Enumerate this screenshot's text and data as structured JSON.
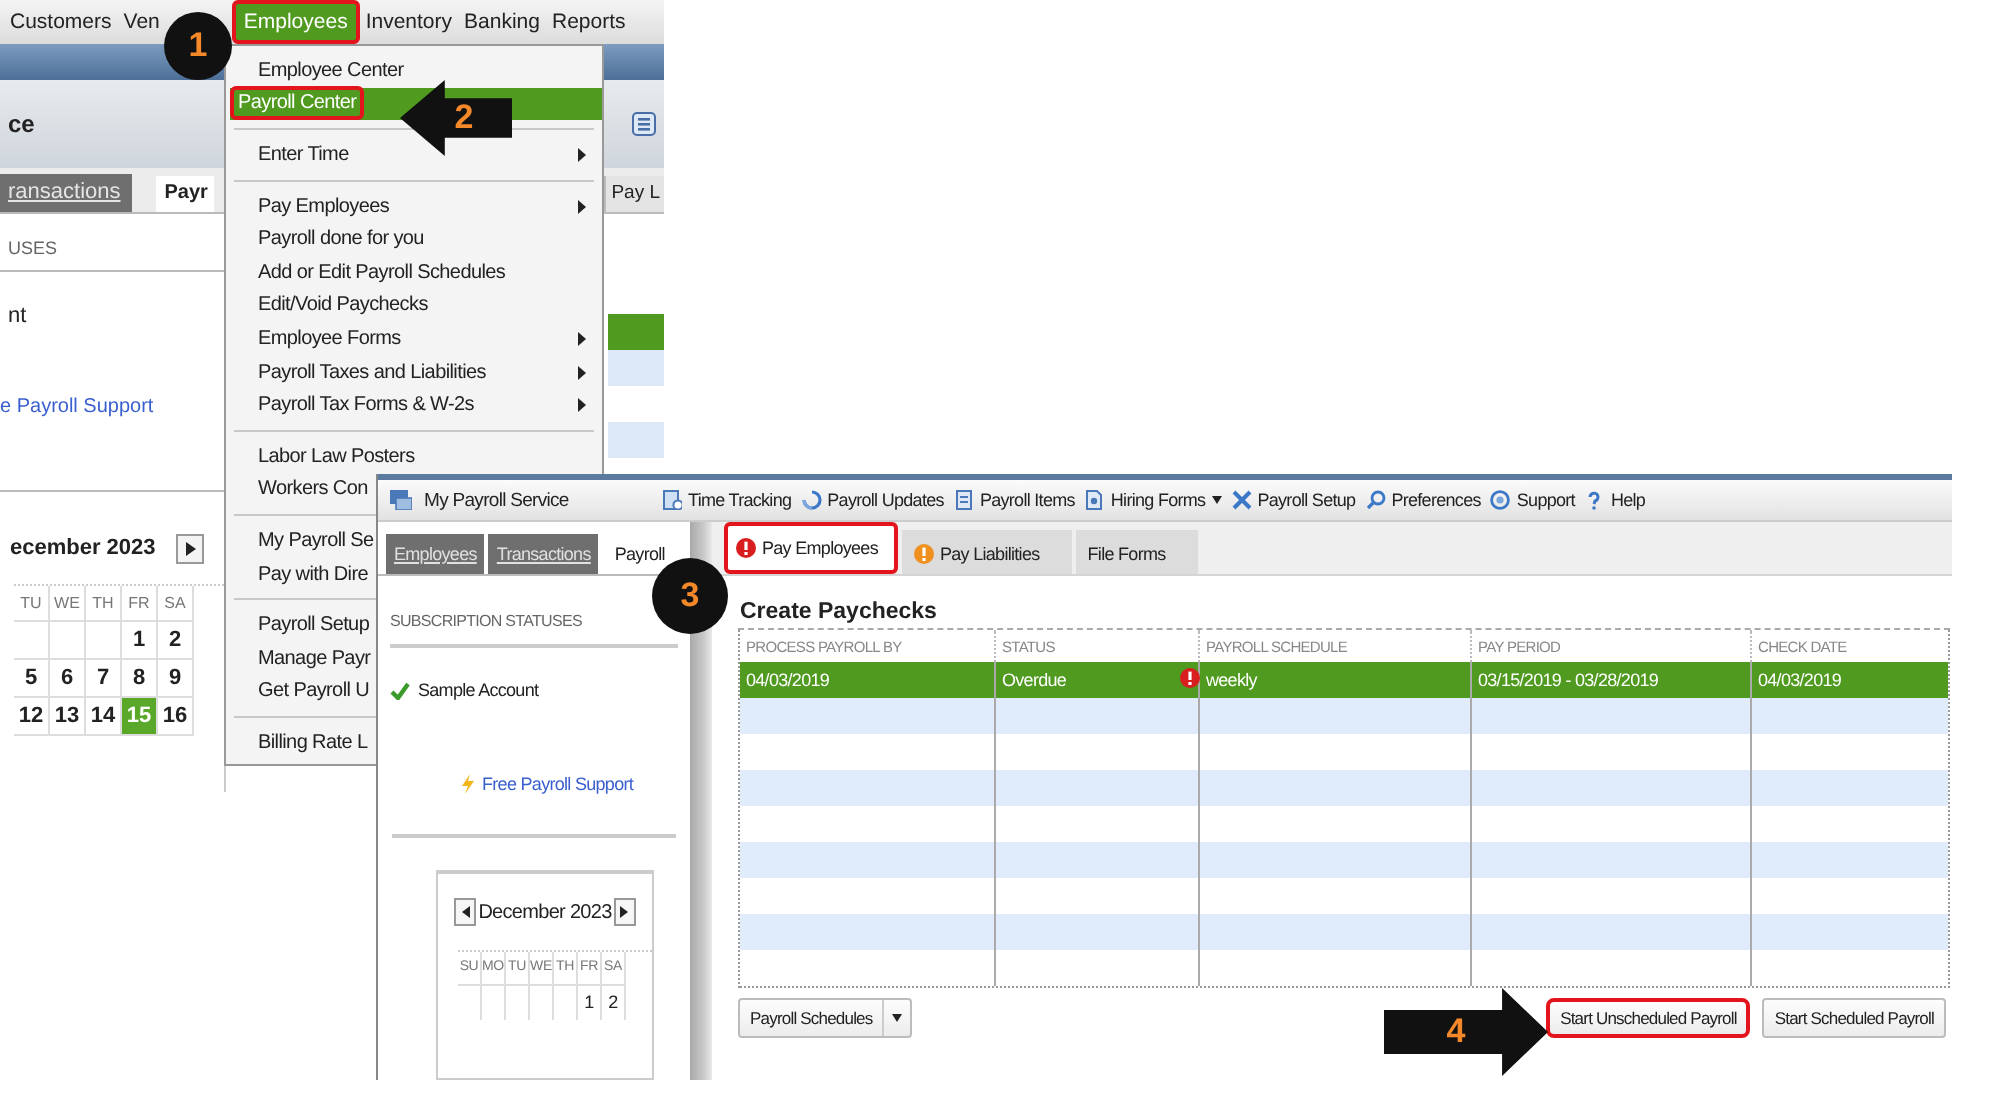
{
  "back_screenshot": {
    "menu_bar": [
      {
        "label": "Customers",
        "selected": false,
        "highlighted": false
      },
      {
        "label": "Ven",
        "selected": false,
        "highlighted": false
      },
      {
        "label": "Employees",
        "selected": true,
        "highlighted": true
      },
      {
        "label": "Inventory",
        "selected": false,
        "highlighted": false
      },
      {
        "label": "Banking",
        "selected": false,
        "highlighted": false
      },
      {
        "label": "Reports",
        "selected": false,
        "highlighted": false
      }
    ],
    "title": "ce",
    "tabs": [
      {
        "label": "ransactions",
        "selected": false
      },
      {
        "label": "Payr",
        "selected": true
      }
    ],
    "right_tab": "Pay L",
    "section_heading": "USES",
    "account": "nt",
    "support_link": "e Payroll Support",
    "calendar": {
      "month": "ecember 2023",
      "day_headers": [
        "TU",
        "WE",
        "TH",
        "FR",
        "SA"
      ],
      "weeks": [
        [
          {
            "day": "1",
            "selected": false
          },
          {
            "day": "2",
            "selected": false
          }
        ],
        [
          {
            "day": "5",
            "selected": false
          },
          {
            "day": "6",
            "selected": false
          },
          {
            "day": "7",
            "selected": false
          },
          {
            "day": "8",
            "selected": false
          },
          {
            "day": "9",
            "selected": false
          }
        ],
        [
          {
            "day": "12",
            "selected": false
          },
          {
            "day": "13",
            "selected": false
          },
          {
            "day": "14",
            "selected": false
          },
          {
            "day": "15",
            "selected": true
          },
          {
            "day": "16",
            "selected": false
          }
        ]
      ]
    },
    "menu": [
      {
        "kind": "item",
        "label": "Employee Center",
        "submenu": false,
        "selected": false,
        "highlighted": false
      },
      {
        "kind": "item",
        "label": "Payroll Center",
        "submenu": false,
        "selected": true,
        "highlighted": true
      },
      {
        "kind": "separator"
      },
      {
        "kind": "item",
        "label": "Enter Time",
        "submenu": true,
        "selected": false,
        "highlighted": false
      },
      {
        "kind": "separator"
      },
      {
        "kind": "item",
        "label": "Pay Employees",
        "submenu": true,
        "selected": false,
        "highlighted": false
      },
      {
        "kind": "item",
        "label": "Payroll done for you",
        "submenu": false,
        "selected": false,
        "highlighted": false
      },
      {
        "kind": "item",
        "label": "Add or Edit Payroll Schedules",
        "submenu": false,
        "selected": false,
        "highlighted": false
      },
      {
        "kind": "item",
        "label": "Edit/Void Paychecks",
        "submenu": false,
        "selected": false,
        "highlighted": false
      },
      {
        "kind": "item",
        "label": "Employee Forms",
        "submenu": true,
        "selected": false,
        "highlighted": false
      },
      {
        "kind": "item",
        "label": "Payroll Taxes and Liabilities",
        "submenu": true,
        "selected": false,
        "highlighted": false
      },
      {
        "kind": "item",
        "label": "Payroll Tax Forms & W-2s",
        "submenu": true,
        "selected": false,
        "highlighted": false
      },
      {
        "kind": "separator"
      },
      {
        "kind": "item",
        "label": "Labor Law Posters",
        "submenu": false,
        "selected": false,
        "highlighted": false
      },
      {
        "kind": "item",
        "label": "Workers Con",
        "submenu": false,
        "selected": false,
        "highlighted": false
      },
      {
        "kind": "separator"
      },
      {
        "kind": "item",
        "label": "My Payroll Se",
        "submenu": false,
        "selected": false,
        "highlighted": false
      },
      {
        "kind": "item",
        "label": "Pay with Dire",
        "submenu": false,
        "selected": false,
        "highlighted": false
      },
      {
        "kind": "separator"
      },
      {
        "kind": "item",
        "label": "Payroll Setup",
        "submenu": false,
        "selected": false,
        "highlighted": false
      },
      {
        "kind": "item",
        "label": "Manage Payr",
        "submenu": false,
        "selected": false,
        "highlighted": false
      },
      {
        "kind": "item",
        "label": "Get Payroll U",
        "submenu": false,
        "selected": false,
        "highlighted": false
      },
      {
        "kind": "separator"
      },
      {
        "kind": "item",
        "label": "Billing Rate L",
        "submenu": false,
        "selected": false,
        "highlighted": false
      }
    ]
  },
  "front_window": {
    "title": "My Payroll Service",
    "toolbar": [
      {
        "label": "Time Tracking",
        "dropdown": false
      },
      {
        "label": "Payroll Updates",
        "dropdown": false
      },
      {
        "label": "Payroll Items",
        "dropdown": false
      },
      {
        "label": "Hiring Forms",
        "dropdown": true
      },
      {
        "label": "Payroll Setup",
        "dropdown": false
      },
      {
        "label": "Preferences",
        "dropdown": false
      },
      {
        "label": "Support",
        "dropdown": false
      },
      {
        "label": "Help",
        "dropdown": false
      }
    ],
    "side_tabs": [
      {
        "label": "Employees",
        "selected": false
      },
      {
        "label": "Transactions",
        "selected": false
      },
      {
        "label": "Payroll",
        "selected": true
      }
    ],
    "subscription_heading": "SUBSCRIPTION STATUSES",
    "account": "Sample Account",
    "support_link": "Free Payroll Support",
    "calendar": {
      "month": "December 2023",
      "day_headers": [
        "SU",
        "MO",
        "TU",
        "WE",
        "TH",
        "FR",
        "SA"
      ],
      "weeks": [
        [
          {
            "day": "1",
            "selected": false
          },
          {
            "day": "2",
            "selected": false
          }
        ]
      ]
    },
    "content_tabs": [
      {
        "label": "Pay Employees",
        "selected": true,
        "alert": true,
        "color": "#d81e1e",
        "highlighted": true
      },
      {
        "label": "Pay Liabilities",
        "selected": false,
        "alert": true,
        "color": "#f0901e",
        "highlighted": false
      },
      {
        "label": "File Forms",
        "selected": false,
        "alert": false,
        "highlighted": false
      }
    ],
    "heading": "Create Paychecks",
    "table": {
      "columns": [
        "PROCESS PAYROLL BY",
        "STATUS",
        "PAYROLL SCHEDULE",
        "PAY PERIOD",
        "CHECK DATE"
      ],
      "rows": [
        {
          "cells": [
            "04/03/2019",
            "Overdue",
            "weekly",
            "03/15/2019 - 03/28/2019",
            "04/03/2019"
          ],
          "selected": true,
          "alert": true
        }
      ]
    },
    "left_buttons": [
      {
        "label": "Payroll Schedules",
        "dropdown": true,
        "highlighted": false
      }
    ],
    "right_buttons": [
      {
        "label": "Start Unscheduled Payroll",
        "dropdown": false,
        "highlighted": true
      },
      {
        "label": "Start Scheduled Payroll",
        "dropdown": false,
        "highlighted": false
      }
    ]
  },
  "annotations": [
    {
      "number": "1",
      "kind": "circle"
    },
    {
      "number": "2",
      "kind": "arrow"
    },
    {
      "number": "3",
      "kind": "circle"
    },
    {
      "number": "4",
      "kind": "arrow"
    }
  ]
}
